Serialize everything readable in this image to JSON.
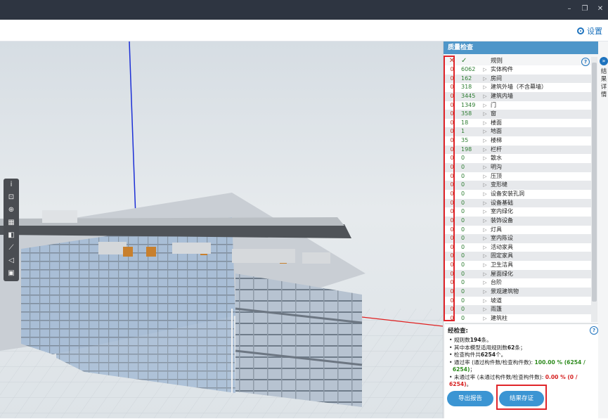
{
  "window": {
    "minimize_glyph": "–",
    "restore_glyph": "❐",
    "close_glyph": "✕"
  },
  "toolbar": {
    "settings_label": "设置"
  },
  "viewport_tools": [
    "i",
    "⊡",
    "⊕",
    "▦",
    "◧",
    "⟋",
    "◁",
    "▣"
  ],
  "panel": {
    "title": "质量检查",
    "side_tab_chars": [
      "结",
      "果",
      "详",
      "情"
    ],
    "help_glyph": "?",
    "header": {
      "fail_icon": "✕",
      "pass_icon": "✓",
      "rule": "规则"
    },
    "rows": [
      {
        "f": "0",
        "p": "6062",
        "n": "实体构件"
      },
      {
        "f": "0",
        "p": "162",
        "n": "房间"
      },
      {
        "f": "0",
        "p": "318",
        "n": "建筑外墙（不含幕墙）"
      },
      {
        "f": "0",
        "p": "3445",
        "n": "建筑内墙"
      },
      {
        "f": "0",
        "p": "1349",
        "n": "门"
      },
      {
        "f": "0",
        "p": "358",
        "n": "窗"
      },
      {
        "f": "0",
        "p": "18",
        "n": "楼面"
      },
      {
        "f": "0",
        "p": "1",
        "n": "地面"
      },
      {
        "f": "0",
        "p": "35",
        "n": "楼梯"
      },
      {
        "f": "0",
        "p": "198",
        "n": "栏杆"
      },
      {
        "f": "0",
        "p": "0",
        "n": "散水"
      },
      {
        "f": "0",
        "p": "0",
        "n": "明沟"
      },
      {
        "f": "0",
        "p": "0",
        "n": "压顶"
      },
      {
        "f": "0",
        "p": "0",
        "n": "变形缝"
      },
      {
        "f": "0",
        "p": "0",
        "n": "设备安装孔洞"
      },
      {
        "f": "0",
        "p": "0",
        "n": "设备基础"
      },
      {
        "f": "0",
        "p": "0",
        "n": "室内绿化"
      },
      {
        "f": "0",
        "p": "0",
        "n": "装饰设备"
      },
      {
        "f": "0",
        "p": "0",
        "n": "灯具"
      },
      {
        "f": "0",
        "p": "0",
        "n": "室内陈设"
      },
      {
        "f": "0",
        "p": "0",
        "n": "活动家具"
      },
      {
        "f": "0",
        "p": "0",
        "n": "固定家具"
      },
      {
        "f": "0",
        "p": "0",
        "n": "卫生洁具"
      },
      {
        "f": "0",
        "p": "0",
        "n": "屋面绿化"
      },
      {
        "f": "0",
        "p": "0",
        "n": "台阶"
      },
      {
        "f": "0",
        "p": "0",
        "n": "景观建筑物"
      },
      {
        "f": "0",
        "p": "0",
        "n": "坡道"
      },
      {
        "f": "0",
        "p": "0",
        "n": "雨篷"
      },
      {
        "f": "0",
        "p": "0",
        "n": "建筑柱"
      }
    ],
    "summary": {
      "title": "经检查:",
      "l1_a": "规则数",
      "l1_b": "194",
      "l1_c": "条。",
      "l2_a": "其中本模型适用规则数",
      "l2_b": "62",
      "l2_c": "条；",
      "l3_a": "检查构件共",
      "l3_b": "6254",
      "l3_c": "个。",
      "l4_a": "通过率 (通过构件数/检查构件数): ",
      "l4_b": "100.00 % (6254 /",
      "l4_c": "6254)",
      "l4_d": "；",
      "l5_a": "未通过率 (未通过构件数/检查构件数): ",
      "l5_b": "0.00 % (0 / 6254)",
      "l5_c": "。"
    },
    "buttons": {
      "export": "导出报告",
      "save": "结果存证"
    }
  }
}
